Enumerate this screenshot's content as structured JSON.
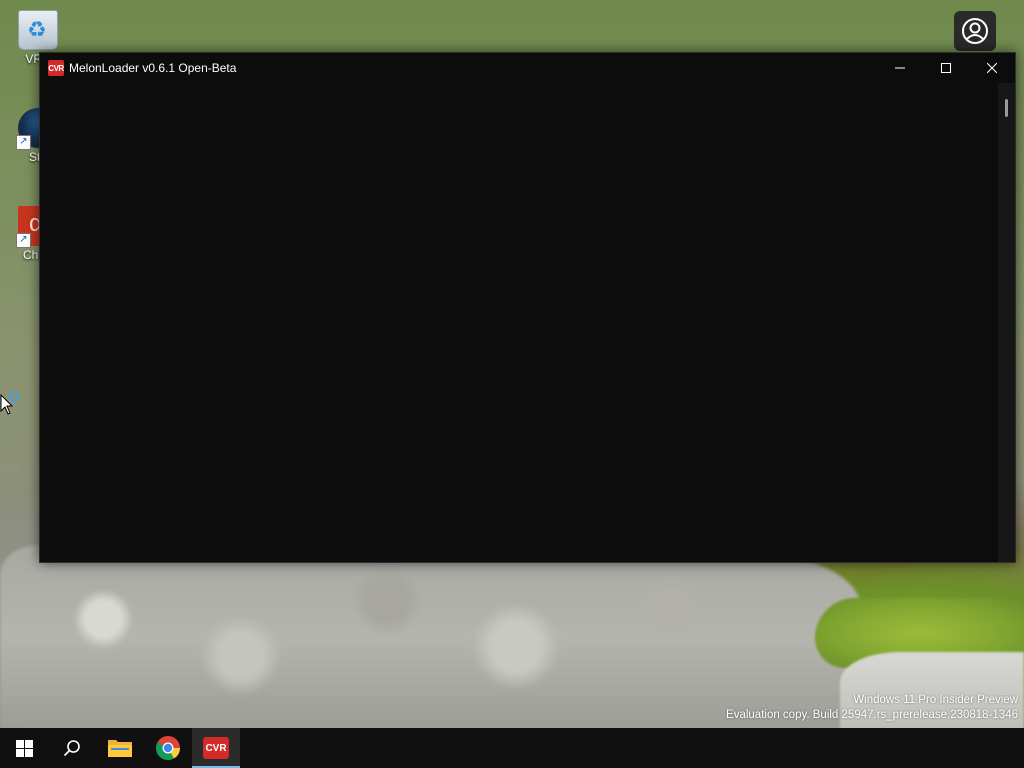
{
  "desktop": {
    "icons": [
      {
        "label": "VRC",
        "icon": "recycle-bin-icon"
      },
      {
        "label": "Ste",
        "icon": "steam-icon"
      },
      {
        "label": "Chillo",
        "icon": "chilloutvr-icon"
      }
    ],
    "overlay_icon": "person-circle-icon"
  },
  "window": {
    "title": "MelonLoader v0.6.1 Open-Beta",
    "app_icon": "melonloader-icon",
    "app_icon_text": "CVR",
    "controls": [
      "minimize",
      "maximize",
      "close"
    ],
    "console_background": "#0c0c0c"
  },
  "watermark": {
    "line1": "Windows 11 Pro Insider Preview",
    "line2": "Evaluation copy. Build 25947.rs_prerelease.230818-1346"
  },
  "taskbar": {
    "items": [
      {
        "name": "start",
        "icon": "windows-start-icon"
      },
      {
        "name": "search",
        "icon": "search-icon"
      },
      {
        "name": "file-explorer",
        "icon": "folder-icon"
      },
      {
        "name": "chrome",
        "icon": "chrome-icon"
      },
      {
        "name": "chilloutvr",
        "icon": "chilloutvr-icon",
        "active": true
      }
    ],
    "accent": "#76b9ed"
  }
}
